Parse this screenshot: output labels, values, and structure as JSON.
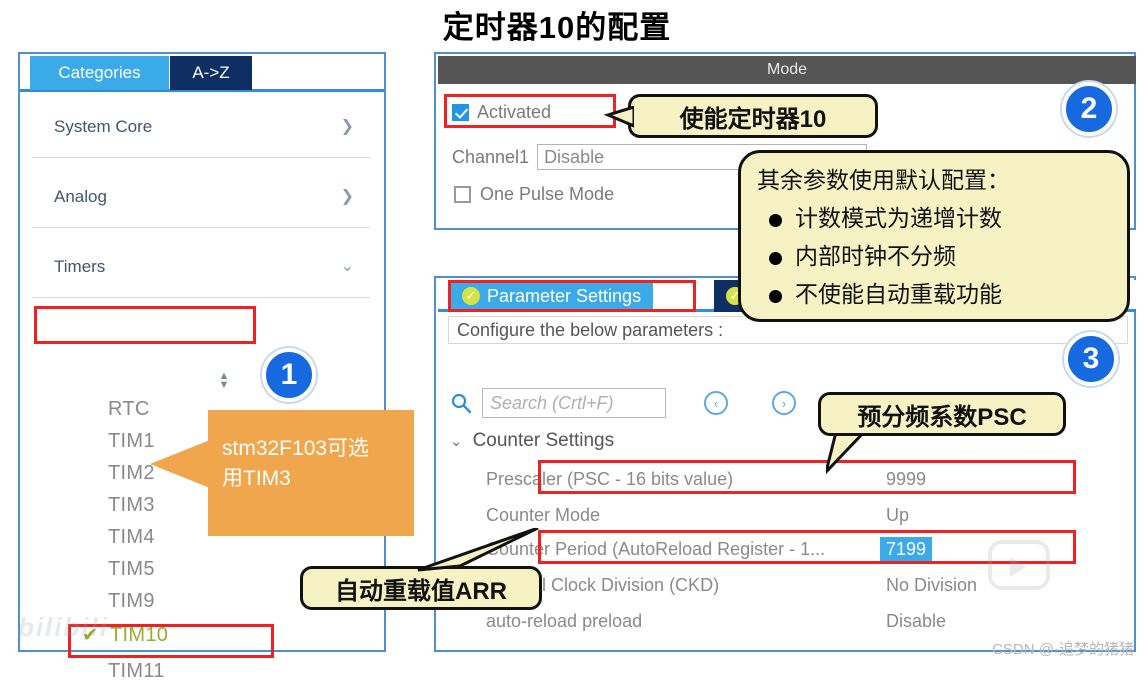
{
  "page": {
    "title": "定时器10的配置",
    "watermark_csdn": "CSDN @-追梦的猪猪",
    "watermark_bili": "bilibili"
  },
  "left_panel": {
    "tabs": [
      {
        "label": "Categories",
        "selected": true
      },
      {
        "label": "A->Z",
        "selected": false
      }
    ],
    "categories": [
      {
        "label": "System Core",
        "chevron": "chevron-right-icon"
      },
      {
        "label": "Analog",
        "chevron": "chevron-right-icon"
      },
      {
        "label": "Timers",
        "chevron": "chevron-down-icon"
      }
    ],
    "timers": [
      {
        "label": "RTC",
        "selected": false
      },
      {
        "label": "TIM1",
        "selected": false
      },
      {
        "label": "TIM2",
        "selected": false
      },
      {
        "label": "TIM3",
        "selected": false
      },
      {
        "label": "TIM4",
        "selected": false
      },
      {
        "label": "TIM5",
        "selected": false
      },
      {
        "label": "TIM9",
        "selected": false
      },
      {
        "label": "TIM10",
        "selected": true,
        "check": "✔"
      },
      {
        "label": "TIM11",
        "selected": false
      }
    ]
  },
  "mode_panel": {
    "header": "Mode",
    "activated": {
      "label": "Activated",
      "checked": true
    },
    "channel1": {
      "label": "Channel1",
      "value": "Disable"
    },
    "one_pulse": {
      "label": "One Pulse Mode",
      "checked": false
    }
  },
  "param_panel": {
    "tabs": [
      {
        "label": "Parameter Settings",
        "selected": true
      },
      {
        "label": "",
        "selected": false
      }
    ],
    "configure_text": "Configure the below parameters :",
    "search": {
      "placeholder": "Search (Crtl+F)",
      "value": "",
      "icon": "search-icon"
    },
    "nav_prev": "‹",
    "nav_next": "›",
    "group_title": "Counter Settings",
    "rows": [
      {
        "name": "Prescaler (PSC - 16 bits value)",
        "value": "9999",
        "selected": false
      },
      {
        "name": "Counter Mode",
        "value": "Up",
        "selected": false
      },
      {
        "name": "Counter Period (AutoReload Register - 1...",
        "value": "7199",
        "selected": true
      },
      {
        "name": "Internal Clock Division (CKD)",
        "value": "No Division",
        "selected": false
      },
      {
        "name": "auto-reload preload",
        "value": "Disable",
        "selected": false
      }
    ]
  },
  "callouts": {
    "enable_timer": "使能定时器10",
    "defaults_head": "其余参数使用默认配置：",
    "defaults_items": [
      "计数模式为递增计数",
      "内部时钟不分频",
      "不使能自动重载功能"
    ],
    "psc": "预分频系数PSC",
    "arr": "自动重载值ARR",
    "tim3_line1": "stm32F103可选",
    "tim3_line2": "用TIM3"
  },
  "badges": {
    "one": "1",
    "two": "2",
    "three": "3"
  },
  "colors": {
    "accent_blue": "#3aaae8",
    "dark_navy": "#0f2f63",
    "highlight_red": "#ee2222",
    "callout_yellow": "#f7f2c4",
    "callout_orange": "#f0a64c",
    "badge_blue": "#1769e0"
  }
}
